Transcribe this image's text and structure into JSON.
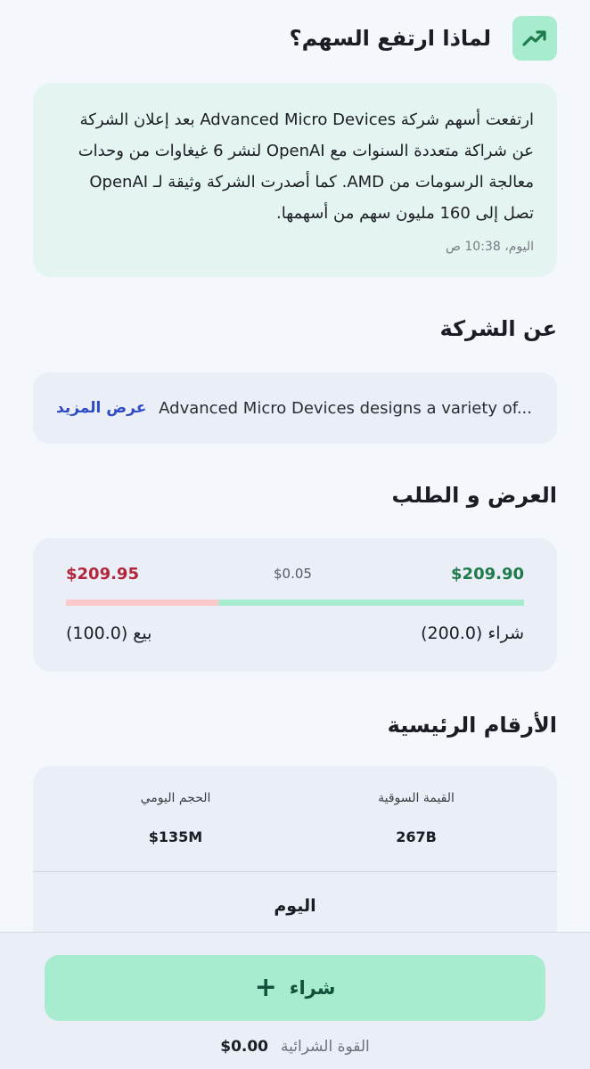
{
  "why": {
    "title": "لماذا ارتفع السهم؟",
    "text": "ارتفعت أسهم شركة Advanced Micro Devices بعد إعلان الشركة عن شراكة متعددة السنوات مع OpenAI لنشر 6 غيغاوات من وحدات معالجة الرسومات من AMD. كما أصدرت الشركة وثيقة لـ OpenAI تصل إلى 160 مليون سهم من أسهمها.",
    "timestamp": "اليوم، 10:38 ص"
  },
  "about": {
    "title": "عن الشركة",
    "snippet": "Advanced Micro Devices designs a variety of...",
    "more_label": "عرض المزيد"
  },
  "bid_ask": {
    "title": "العرض و الطلب",
    "ask_price": "$209.95",
    "spread": "$0.05",
    "bid_price": "$209.90",
    "sell_label": "بيع (100.0)",
    "buy_label": "شراء (200.0)",
    "sell_fraction": 0.333,
    "colors": {
      "ask": "#b3263a",
      "bid": "#1f7a4c",
      "sell_bar": "#ffc9c9",
      "buy_bar": "#a8ecd0"
    }
  },
  "key_figures": {
    "title": "الأرقام الرئيسية",
    "market_cap_label": "القيمة السوقية",
    "market_cap_value": "267B",
    "daily_volume_label": "الحجم اليومي",
    "daily_volume_value": "$135M",
    "today_label": "اليوم"
  },
  "footer": {
    "buy_label": "شراء",
    "buying_power_label": "القوة الشرائية",
    "buying_power_value": "$0.00"
  },
  "icons": {
    "trend": "trending-up-icon",
    "plus": "plus-icon"
  }
}
